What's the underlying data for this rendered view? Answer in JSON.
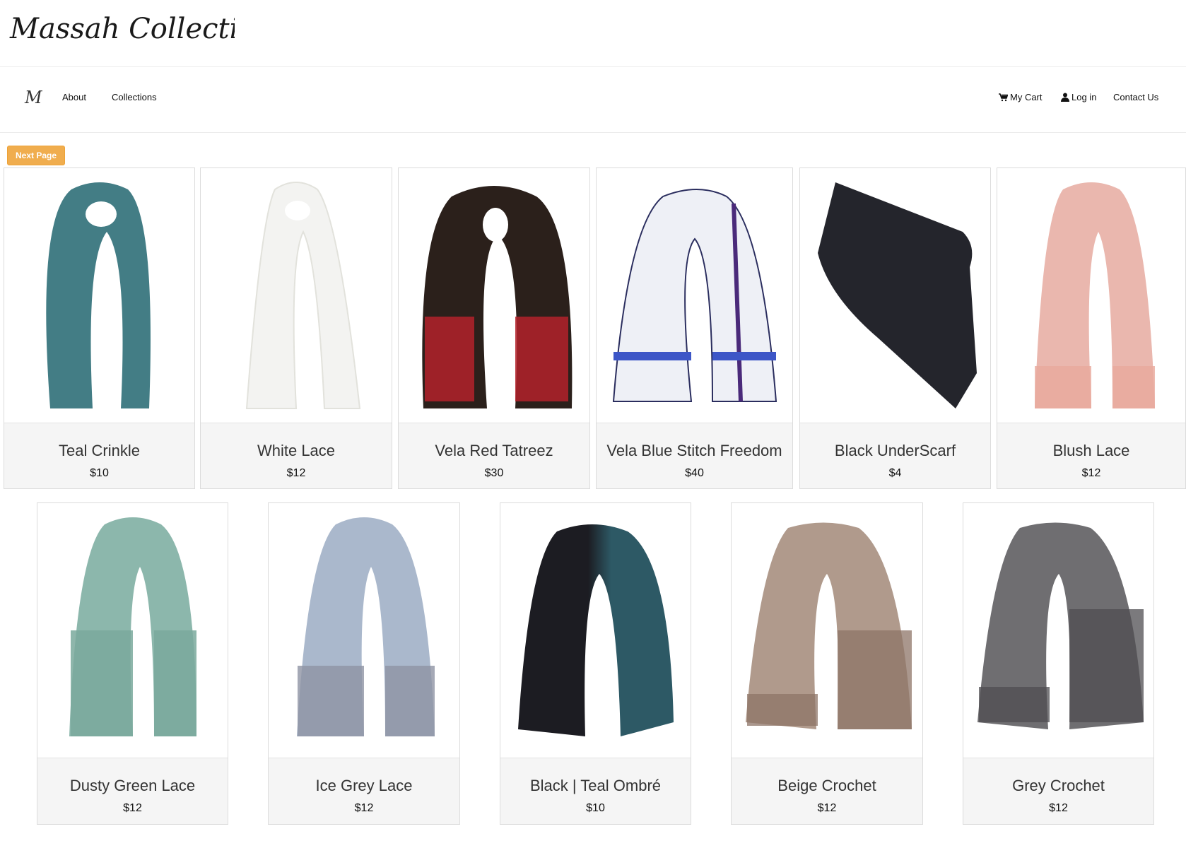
{
  "brand": {
    "logo_text": "Massah Collection",
    "monogram": "M"
  },
  "nav": {
    "left": [
      {
        "label": "About"
      },
      {
        "label": "Collections"
      }
    ],
    "right": [
      {
        "label": "My Cart",
        "icon": "cart-icon"
      },
      {
        "label": "Log in",
        "icon": "user-icon"
      },
      {
        "label": "Contact Us"
      }
    ]
  },
  "next_page_label": "Next Page",
  "colors": {
    "button": "#f0ad4e",
    "caption_bg": "#f5f5f5"
  },
  "products": [
    {
      "name": "Teal Crinkle",
      "price": "$10",
      "color": "#2f6f78"
    },
    {
      "name": "White Lace",
      "price": "$12",
      "color": "#f3f3f1"
    },
    {
      "name": "Vela Red Tatreez",
      "price": "$30",
      "color": "#2b201b"
    },
    {
      "name": "Vela Blue Stitch Freedom",
      "price": "$40",
      "color": "#e9ecf3"
    },
    {
      "name": "Black UnderScarf",
      "price": "$4",
      "color": "#24252c"
    },
    {
      "name": "Blush Lace",
      "price": "$12",
      "color": "#eab7ae"
    },
    {
      "name": "Dusty Green Lace",
      "price": "$12",
      "color": "#8cb7ac"
    },
    {
      "name": "Ice Grey Lace",
      "price": "$12",
      "color": "#aab8cc"
    },
    {
      "name": "Black | Teal Ombré",
      "price": "$10",
      "color": "#27404a"
    },
    {
      "name": "Beige Crochet",
      "price": "$12",
      "color": "#b09a8c"
    },
    {
      "name": "Grey Crochet",
      "price": "$12",
      "color": "#6f6e71"
    }
  ]
}
